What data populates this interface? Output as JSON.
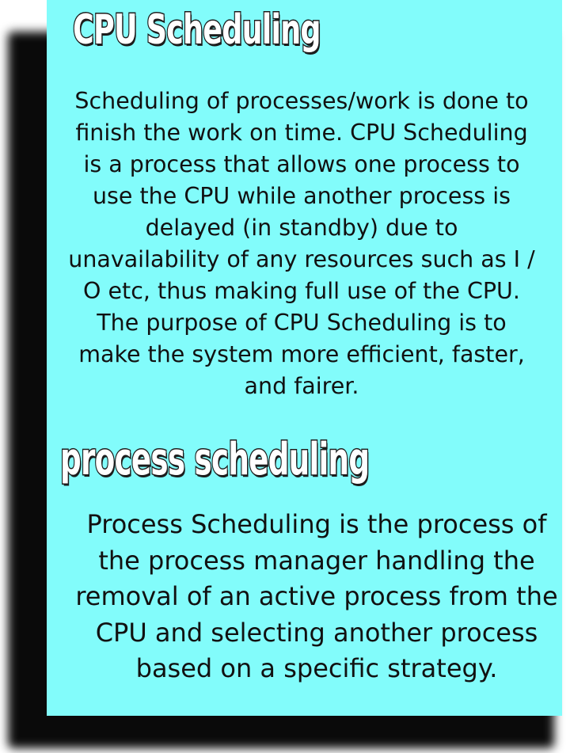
{
  "sections": [
    {
      "heading": "CPU Scheduling",
      "body": "Scheduling of processes/work is done to finish the work on time. CPU Scheduling is a process that allows one process to use the CPU while another process is delayed (in standby) due to unavailability of any resources such as I / O etc, thus making full use of the CPU. The purpose of CPU Scheduling is to make the system more efficient, faster, and fairer."
    },
    {
      "heading": "process scheduling",
      "body": "Process Scheduling is the process of the process manager handling the removal of an active process from the CPU and selecting another process based on a specific strategy."
    }
  ],
  "colors": {
    "card_background": "#82fcfb",
    "shadow": "#0a0a0a",
    "heading_fill": "#ffffff",
    "heading_outline": "#1c1c1c",
    "body_text": "#111111"
  }
}
